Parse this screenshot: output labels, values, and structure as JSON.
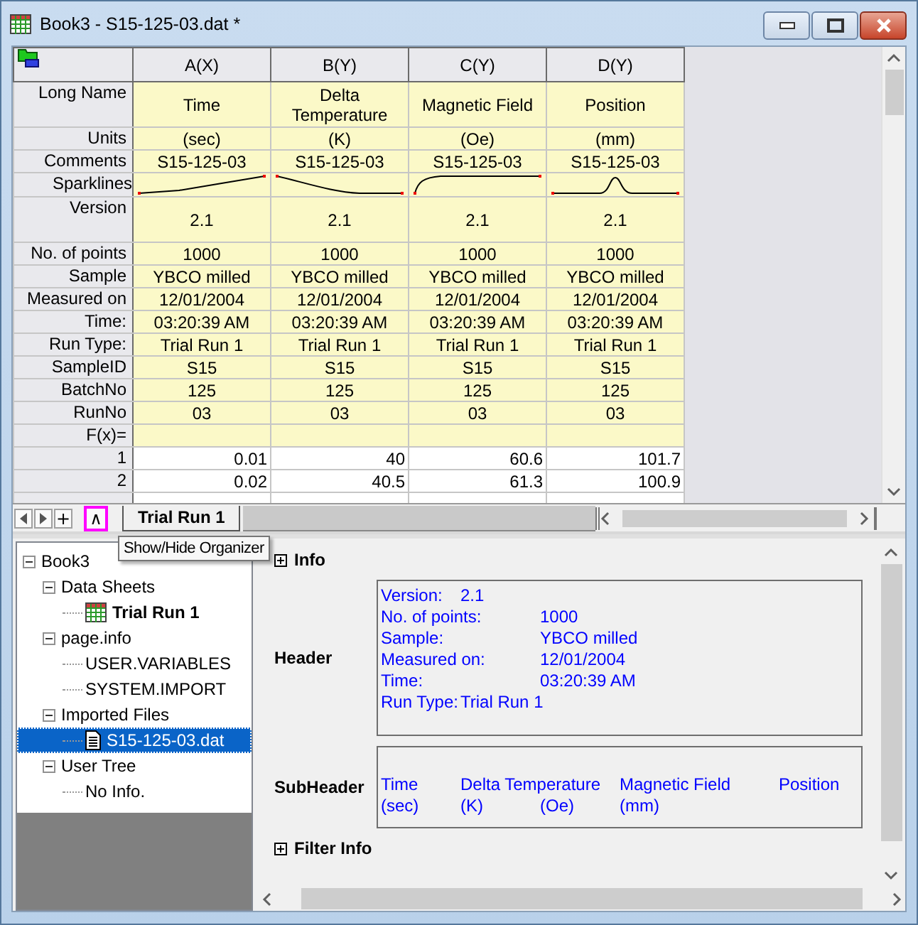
{
  "window": {
    "title": "Book3 - S15-125-03.dat *"
  },
  "sheet": {
    "columns": [
      "A(X)",
      "B(Y)",
      "C(Y)",
      "D(Y)"
    ],
    "label_rows": [
      {
        "label": "Long Name",
        "kind": "text",
        "cells": [
          "Time",
          "Delta Temperature",
          "Magnetic Field",
          "Position"
        ]
      },
      {
        "label": "Units",
        "kind": "text",
        "cells": [
          "(sec)",
          "(K)",
          "(Oe)",
          "(mm)"
        ]
      },
      {
        "label": "Comments",
        "kind": "text",
        "cells": [
          "S15-125-03",
          "S15-125-03",
          "S15-125-03",
          "S15-125-03"
        ]
      },
      {
        "label": "Sparklines",
        "kind": "sparkline"
      },
      {
        "label": "Version",
        "kind": "text",
        "cells": [
          "2.1",
          "2.1",
          "2.1",
          "2.1"
        ]
      },
      {
        "label": "No. of points",
        "kind": "text",
        "cells": [
          "1000",
          "1000",
          "1000",
          "1000"
        ]
      },
      {
        "label": "Sample",
        "kind": "text",
        "cells": [
          "YBCO milled",
          "YBCO milled",
          "YBCO milled",
          "YBCO milled"
        ]
      },
      {
        "label": "Measured on",
        "kind": "text",
        "cells": [
          "12/01/2004",
          "12/01/2004",
          "12/01/2004",
          "12/01/2004"
        ]
      },
      {
        "label": "Time:",
        "kind": "text",
        "cells": [
          "03:20:39 AM",
          "03:20:39 AM",
          "03:20:39 AM",
          "03:20:39 AM"
        ]
      },
      {
        "label": "Run Type:",
        "kind": "text",
        "cells": [
          "Trial Run 1",
          "Trial Run 1",
          "Trial Run 1",
          "Trial Run 1"
        ]
      },
      {
        "label": "SampleID",
        "kind": "text",
        "cells": [
          "S15",
          "S15",
          "S15",
          "S15"
        ]
      },
      {
        "label": "BatchNo",
        "kind": "text",
        "cells": [
          "125",
          "125",
          "125",
          "125"
        ]
      },
      {
        "label": "RunNo",
        "kind": "text",
        "cells": [
          "03",
          "03",
          "03",
          "03"
        ]
      },
      {
        "label": "F(x)=",
        "kind": "formula"
      }
    ],
    "data_rows": [
      {
        "label": "1",
        "cells": [
          "0.01",
          "40",
          "60.6",
          "101.7"
        ]
      },
      {
        "label": "2",
        "cells": [
          "0.02",
          "40.5",
          "61.3",
          "100.9"
        ]
      }
    ]
  },
  "tab_bar": {
    "buttons": [
      {
        "kind": "prev"
      },
      {
        "kind": "next"
      },
      {
        "kind": "text",
        "text": "+",
        "highlighted": false
      },
      {
        "kind": "text",
        "text": "∧",
        "highlighted": true
      }
    ],
    "tabs": [
      {
        "label": "Trial Run 1",
        "selected": true
      }
    ]
  },
  "tooltip": "Show/Hide Organizer",
  "tree": [
    {
      "label": "Book3",
      "kind": "folder",
      "expanded": true,
      "selected": false,
      "children": [
        {
          "label": "Data Sheets",
          "kind": "folder",
          "expanded": true,
          "selected": false,
          "children": [
            {
              "label": "Trial Run 1",
              "kind": "sheet",
              "selected": false
            }
          ]
        },
        {
          "label": "page.info",
          "kind": "folder",
          "expanded": true,
          "selected": false,
          "children": [
            {
              "label": "USER.VARIABLES",
              "kind": "leaf",
              "selected": false
            },
            {
              "label": "SYSTEM.IMPORT",
              "kind": "leaf",
              "selected": false
            }
          ]
        },
        {
          "label": "Imported Files",
          "kind": "folder",
          "expanded": true,
          "selected": false,
          "children": [
            {
              "label": "S15-125-03.dat",
              "kind": "file",
              "selected": true
            }
          ]
        },
        {
          "label": "User Tree",
          "kind": "folder",
          "expanded": true,
          "selected": false,
          "children": [
            {
              "label": "No Info.",
              "kind": "leaf",
              "selected": false
            }
          ]
        }
      ]
    }
  ],
  "organizer": [
    {
      "kind": "group",
      "label": "Info",
      "expanded": false
    },
    {
      "kind": "fields",
      "label": "Header",
      "rows": [
        [
          "Version:",
          "2.1"
        ],
        [
          "No. of points:",
          "",
          "1000"
        ],
        [
          "Sample:",
          "",
          "YBCO milled"
        ],
        [
          "Measured on:",
          "",
          "12/01/2004"
        ],
        [
          "Time:",
          "",
          "03:20:39 AM"
        ],
        [
          "Run Type:",
          "Trial Run 1"
        ]
      ]
    },
    {
      "kind": "columns",
      "label": "SubHeader",
      "rows": [
        [
          "Time",
          "Delta Temperature",
          "",
          "Magnetic Field",
          "",
          "Position"
        ],
        [
          "(sec)",
          "(K)",
          "(Oe)",
          "(mm)"
        ]
      ]
    },
    {
      "kind": "group",
      "label": "Filter Info",
      "expanded": false
    }
  ]
}
